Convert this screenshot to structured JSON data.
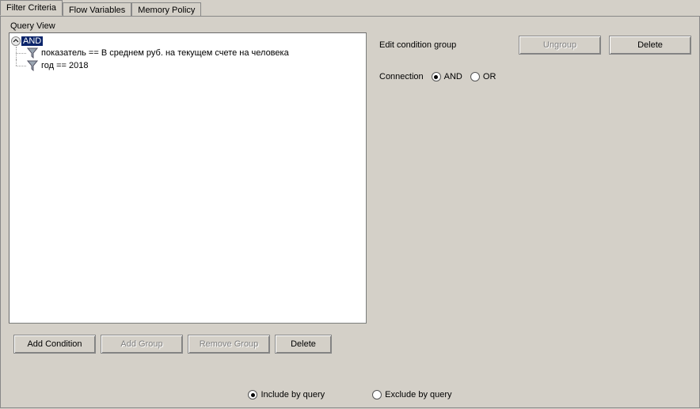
{
  "tabs": {
    "filter": "Filter Criteria",
    "flow": "Flow Variables",
    "memory": "Memory Policy",
    "active": "filter"
  },
  "queryView": {
    "label": "Query View",
    "root": "AND",
    "conditions": [
      "показатель == В среднем руб. на текущем счете на человека",
      "год == 2018"
    ]
  },
  "buttons": {
    "addCondition": "Add Condition",
    "addGroup": "Add Group",
    "removeGroup": "Remove Group",
    "delete": "Delete",
    "ungroup": "Ungroup",
    "deleteRight": "Delete"
  },
  "editGroup": {
    "label": "Edit condition group",
    "connectionLabel": "Connection",
    "and": "AND",
    "or": "OR",
    "selected": "AND"
  },
  "includeExclude": {
    "include": "Include by query",
    "exclude": "Exclude by query",
    "selected": "include"
  }
}
